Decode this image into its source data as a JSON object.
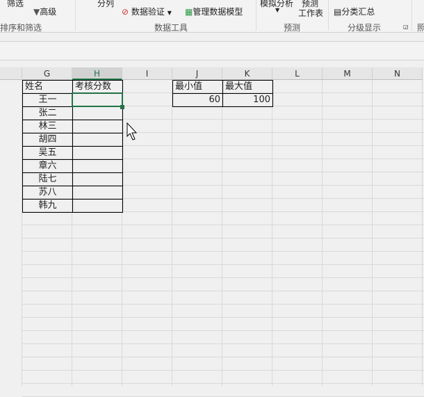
{
  "ribbon": {
    "filter": "筛选",
    "advanced": "高级",
    "sort_filter_group": "排序和筛选",
    "split": "分列",
    "data_validation": "数据验证",
    "manage_model": "管理数据模型",
    "data_tools_group": "数据工具",
    "what_if": "模拟分析",
    "forecast_sheet_1": "预测",
    "forecast_sheet_2": "工作表",
    "forecast_group": "预测",
    "subtotal": "分类汇总",
    "outline_group": "分级显示",
    "next_group": "照"
  },
  "columns": [
    "G",
    "H",
    "I",
    "J",
    "K",
    "L",
    "M",
    "N"
  ],
  "selected_column": "H",
  "table1": {
    "headers": [
      "姓名",
      "考核分数"
    ],
    "names": [
      "王一",
      "张二",
      "林三",
      "胡四",
      "吴五",
      "章六",
      "陆七",
      "苏八",
      "韩九"
    ]
  },
  "table2": {
    "headers": [
      "最小值",
      "最大值"
    ],
    "values": [
      "60",
      "100"
    ]
  },
  "colors": {
    "accent": "#217346"
  }
}
